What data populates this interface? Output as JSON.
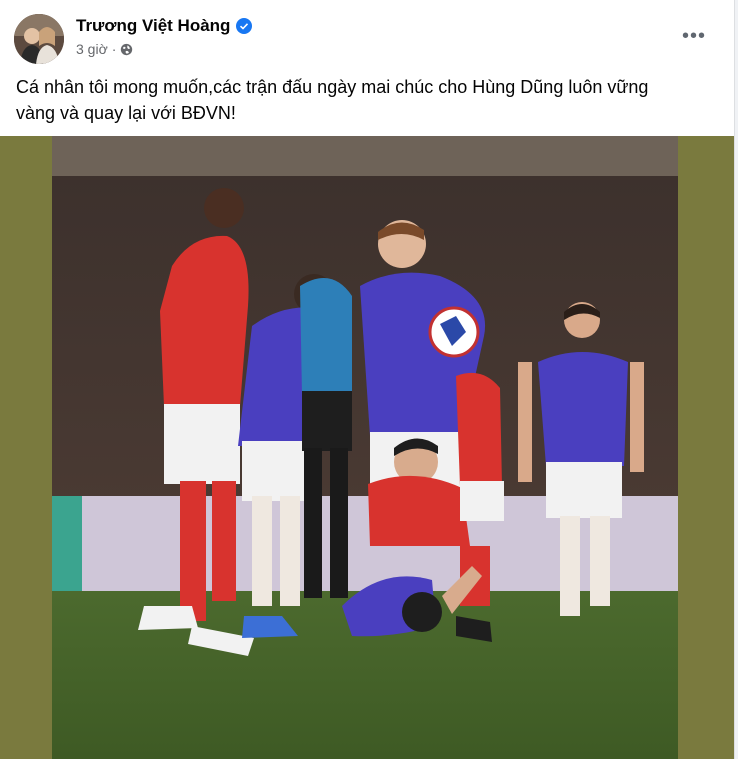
{
  "post": {
    "author": "Trương Việt Hoàng",
    "verified_icon": "verified-badge-icon",
    "time": "3 giờ",
    "separator": "·",
    "audience_icon": "globe-icon",
    "more_icon": "more-options-icon",
    "more_label": "•••",
    "text_line1": "Cá nhân tôi mong muốn,các trận đấu ngày mai chúc cho Hùng Dũng luôn vững",
    "text_line2": "vàng và quay lại với BĐVN!"
  },
  "colors": {
    "accent": "#1877f2",
    "media_background": "#7a7a3e",
    "home_kit": "#d8332e",
    "away_kit": "#4a3fbf"
  }
}
